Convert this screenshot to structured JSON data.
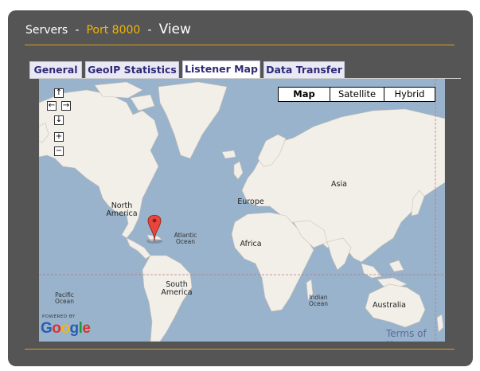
{
  "breadcrumb": {
    "servers": "Servers",
    "separator": "-",
    "port": "Port 8000",
    "view": "View"
  },
  "tabs": [
    {
      "label": "General",
      "active": false
    },
    {
      "label": "GeoIP Statistics",
      "active": false
    },
    {
      "label": "Listener Map",
      "active": true
    },
    {
      "label": "Data Transfer",
      "active": false
    }
  ],
  "map": {
    "types": [
      "Map",
      "Satellite",
      "Hybrid"
    ],
    "selected_type": "Map",
    "labels": {
      "north_america": "North America",
      "europe": "Europe",
      "asia": "Asia",
      "africa": "Africa",
      "south_america": "South America",
      "australia": "Australia",
      "atlantic": "Atlantic Ocean",
      "pacific": "Pacific Ocean",
      "indian": "Indian Ocean"
    },
    "powered_by": "POWERED BY",
    "logo": "Google",
    "terms": "Terms of Use",
    "controls": {
      "up": "↑",
      "left": "←",
      "right": "→",
      "down": "↓",
      "zoom_in": "+",
      "zoom_out": "−"
    }
  },
  "colors": {
    "panel": "#555555",
    "accent": "#f4b400",
    "rule": "#d9a21b",
    "tab_text": "#2e2a76",
    "ocean": "#99b3cc",
    "land": "#f2efe9",
    "marker": "#e8453c"
  }
}
